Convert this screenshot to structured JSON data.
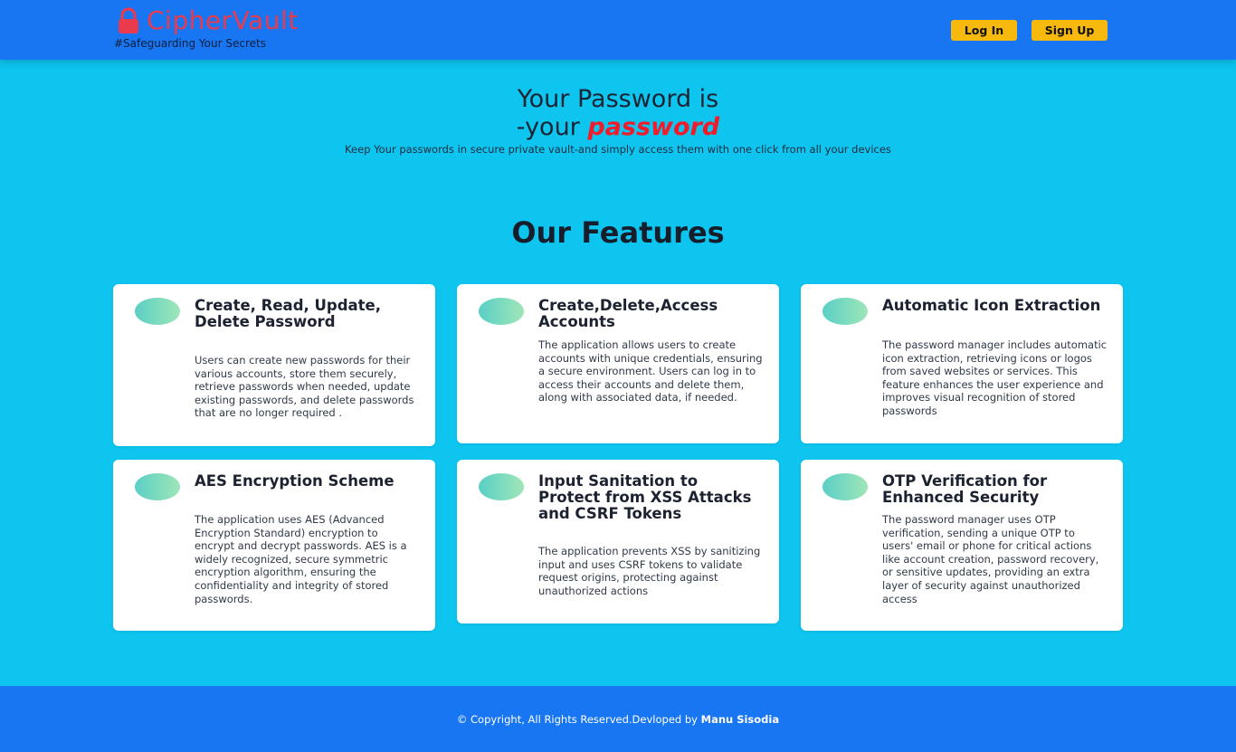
{
  "header": {
    "brand_name": "CipherVault",
    "tagline": "#Safeguarding Your Secrets",
    "login_label": "Log In",
    "signup_label": "Sign Up",
    "colors": {
      "bar": "#1876f2",
      "brand": "#ea3a4d",
      "button": "#f7b90e"
    }
  },
  "hero": {
    "title_line1": "Your Password is",
    "title_line2_prefix": "-your ",
    "title_line2_emphasis": "password",
    "subtitle": "Keep Your passwords in secure private vault-and simply access them with one click from all your devices"
  },
  "features": {
    "heading": "Our Features",
    "cards": [
      {
        "title": "Create, Read, Update, Delete Password",
        "text": "Users can create new passwords for their various accounts, store them securely, retrieve passwords when needed, update existing passwords, and delete passwords that are no longer required ."
      },
      {
        "title": "Create,Delete,Access Accounts",
        "text": "The application allows users to create accounts with unique credentials, ensuring a secure environment. Users can log in to access their accounts and delete them, along with associated data, if needed."
      },
      {
        "title": "Automatic Icon Extraction",
        "text": "The password manager includes automatic icon extraction, retrieving icons or logos from saved websites or services. This feature enhances the user experience and improves visual recognition of stored passwords"
      },
      {
        "title": "AES Encryption Scheme",
        "text": "The application uses AES (Advanced Encryption Standard) encryption to encrypt and decrypt passwords. AES is a widely recognized, secure symmetric encryption algorithm, ensuring the confidentiality and integrity of stored passwords."
      },
      {
        "title": "Input Sanitation to Protect from XSS Attacks and CSRF Tokens",
        "text": "The application prevents XSS by sanitizing input and uses CSRF tokens to validate request origins, protecting against unauthorized actions"
      },
      {
        "title": "OTP Verification for Enhanced Security",
        "text": "The password manager uses OTP verification, sending a unique OTP to users' email or phone for critical actions like account creation, password recovery, or sensitive updates, providing an extra layer of security against unauthorized access"
      }
    ]
  },
  "footer": {
    "text": "© Copyright, All Rights Reserved.Devloped by ",
    "author": "Manu Sisodia"
  }
}
